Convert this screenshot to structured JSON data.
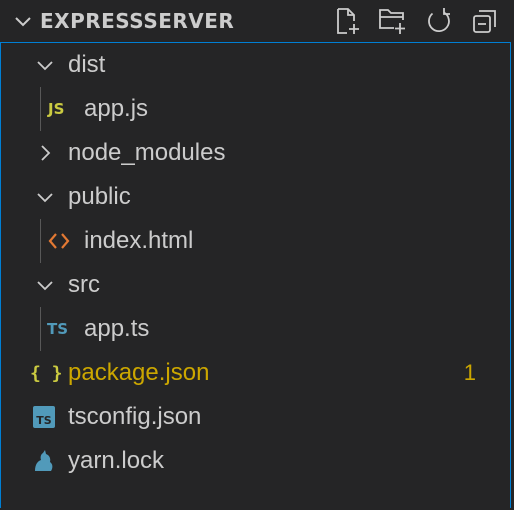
{
  "section": {
    "title": "EXPRESSSERVER",
    "actions": [
      {
        "icon": "new-file-icon",
        "label": "New File"
      },
      {
        "icon": "new-folder-icon",
        "label": "New Folder"
      },
      {
        "icon": "refresh-icon",
        "label": "Refresh Explorer"
      },
      {
        "icon": "collapse-all-icon",
        "label": "Collapse Folders in View"
      }
    ]
  },
  "tree": {
    "dist": {
      "label": "dist",
      "state": "expanded"
    },
    "dist_app_js": {
      "label": "app.js",
      "icon": "javascript-file-icon",
      "icon_text": "JS",
      "icon_color": "#cbcb41"
    },
    "node_modules": {
      "label": "node_modules",
      "state": "collapsed"
    },
    "public": {
      "label": "public",
      "state": "expanded"
    },
    "public_index_html": {
      "label": "index.html",
      "icon": "html-file-icon",
      "icon_color": "#e37933"
    },
    "src": {
      "label": "src",
      "state": "expanded"
    },
    "src_app_ts": {
      "label": "app.ts",
      "icon": "typescript-file-icon",
      "icon_text": "TS",
      "icon_color": "#519aba"
    },
    "package_json": {
      "label": "package.json",
      "icon": "json-file-icon",
      "icon_text": "{ }",
      "icon_color": "#cbcb41",
      "label_color": "#cca700",
      "problem_count": "1"
    },
    "tsconfig_json": {
      "label": "tsconfig.json",
      "icon": "tsconfig-file-icon",
      "icon_color": "#519aba"
    },
    "yarn_lock": {
      "label": "yarn.lock",
      "icon": "yarn-file-icon",
      "icon_color": "#519aba"
    }
  },
  "colors": {
    "background": "#252526",
    "text": "#cccccc",
    "focus_border": "#007fd4",
    "warning": "#cca700",
    "indent_guide": "#585858"
  }
}
